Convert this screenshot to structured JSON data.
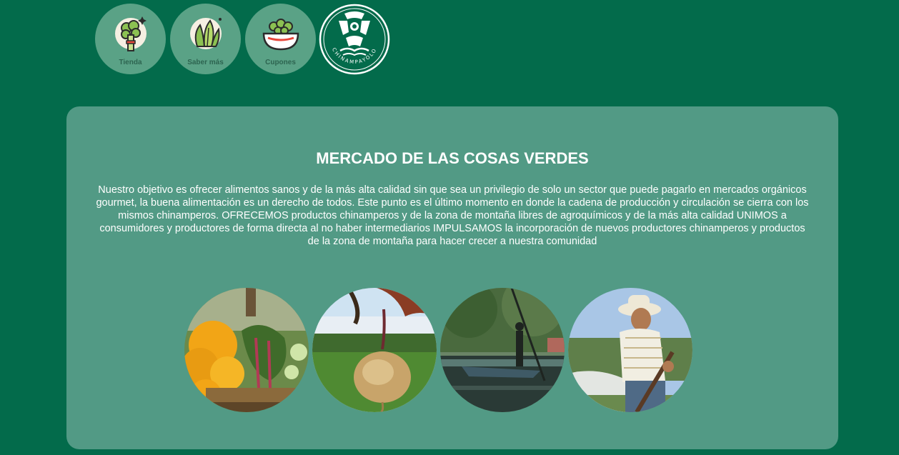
{
  "nav": {
    "items": [
      {
        "label": "Tienda",
        "icon": "broccoli-icon"
      },
      {
        "label": "Saber más",
        "icon": "lettuce-icon"
      },
      {
        "label": "Cupones",
        "icon": "bowl-icon"
      }
    ],
    "logo": {
      "text": "CHINAMPAYOLO",
      "icon": "chinampayolo-logo"
    }
  },
  "main": {
    "title": "MERCADO DE LAS COSAS VERDES",
    "description": "Nuestro objetivo es ofrecer alimentos sanos y de la más alta calidad sin que sea un privilegio de solo un sector que puede pagarlo en mercados orgánicos gourmet, la buena alimentación es un derecho de todos. Este punto es el último momento en donde la cadena de producción y circulación se cierra con los mismos chinamperos. OFRECEMOS productos chinamperos y de la zona de montaña libres de agroquímicos y de la más alta calidad UNIMOS a consumidores y productores de forma directa al no haber intermediarios IMPULSAMOS la incorporación de nuevos productores chinamperos y productos de la zona de montaña para hacer crecer a nuestra comunidad",
    "photos": [
      "flowers-photo",
      "beet-harvest-photo",
      "canal-boat-photo",
      "farmer-photo"
    ]
  },
  "colors": {
    "background": "#036b4b",
    "card": "#529a85",
    "nav_button": "#5aa286",
    "text": "#ffffff"
  }
}
